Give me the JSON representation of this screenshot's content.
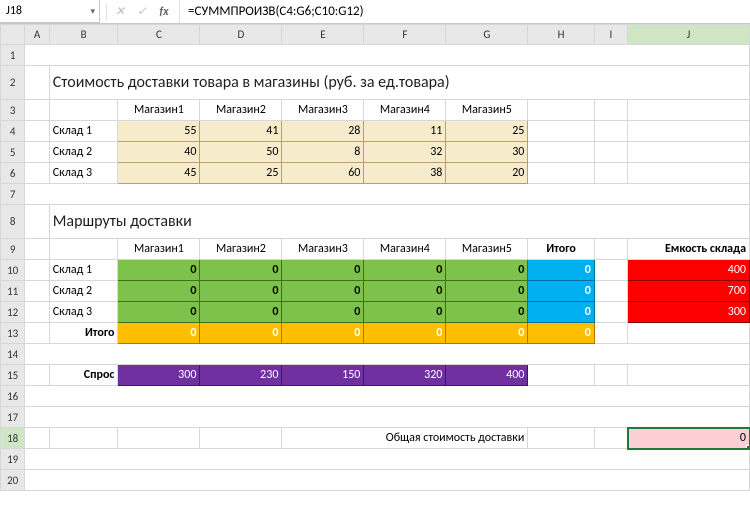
{
  "formula_bar": {
    "cell_ref": "J18",
    "fx_label": "fx",
    "x_icon": "✕",
    "check_icon": "✓",
    "formula": "=СУММПРОИЗВ(C4:G6;C10:G12)"
  },
  "columns": [
    "A",
    "B",
    "C",
    "D",
    "E",
    "F",
    "G",
    "H",
    "I",
    "J"
  ],
  "row_numbers": [
    "1",
    "2",
    "3",
    "4",
    "5",
    "6",
    "7",
    "8",
    "9",
    "10",
    "11",
    "12",
    "13",
    "14",
    "15",
    "16",
    "17",
    "18",
    "19",
    "20"
  ],
  "titles": {
    "cost": "Стоимость доставки товара в магазины (руб. за ед.товара)",
    "routes": "Маршруты доставки"
  },
  "shops": [
    "Магазин1",
    "Магазин2",
    "Магазин3",
    "Магазин4",
    "Магазин5"
  ],
  "warehouses": [
    "Склад 1",
    "Склад 2",
    "Склад 3"
  ],
  "cost_matrix": [
    [
      55,
      41,
      28,
      11,
      25
    ],
    [
      40,
      50,
      8,
      32,
      30
    ],
    [
      45,
      25,
      60,
      38,
      20
    ]
  ],
  "routes_headers_extra": {
    "total": "Итого",
    "capacity": "Емкость склада"
  },
  "route_matrix": [
    [
      0,
      0,
      0,
      0,
      0
    ],
    [
      0,
      0,
      0,
      0,
      0
    ],
    [
      0,
      0,
      0,
      0,
      0
    ]
  ],
  "route_row_totals": [
    0,
    0,
    0
  ],
  "capacity": [
    400,
    700,
    300
  ],
  "col_totals_label": "Итого",
  "col_totals": [
    0,
    0,
    0,
    0,
    0,
    0
  ],
  "demand_label": "Спрос",
  "demand": [
    300,
    230,
    150,
    320,
    400
  ],
  "grand_total_label": "Общая стоимость доставки",
  "grand_total": 0,
  "chart_data": {
    "type": "table",
    "title": "Стоимость доставки товара в магазины (руб. за ед.товара)",
    "columns": [
      "Магазин1",
      "Магазин2",
      "Магазин3",
      "Магазин4",
      "Магазин5"
    ],
    "rows": [
      "Склад 1",
      "Склад 2",
      "Склад 3"
    ],
    "values": [
      [
        55,
        41,
        28,
        11,
        25
      ],
      [
        40,
        50,
        8,
        32,
        30
      ],
      [
        45,
        25,
        60,
        38,
        20
      ]
    ]
  }
}
